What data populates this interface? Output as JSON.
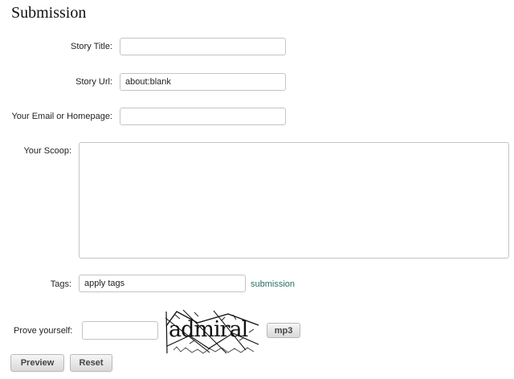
{
  "page": {
    "title": "Submission"
  },
  "form": {
    "story_title": {
      "label": "Story Title:",
      "value": "",
      "placeholder": ""
    },
    "story_url": {
      "label": "Story Url:",
      "value": "about:blank"
    },
    "email": {
      "label": "Your Email or Homepage:",
      "value": ""
    },
    "scoop": {
      "label": "Your Scoop:",
      "value": ""
    },
    "tags": {
      "label": "Tags:",
      "value": "apply tags",
      "link": "submission"
    },
    "captcha": {
      "label": "Prove yourself:",
      "value": "",
      "image_text": "admiral",
      "audio_button": "mp3"
    }
  },
  "actions": {
    "preview": "Preview",
    "reset": "Reset"
  }
}
